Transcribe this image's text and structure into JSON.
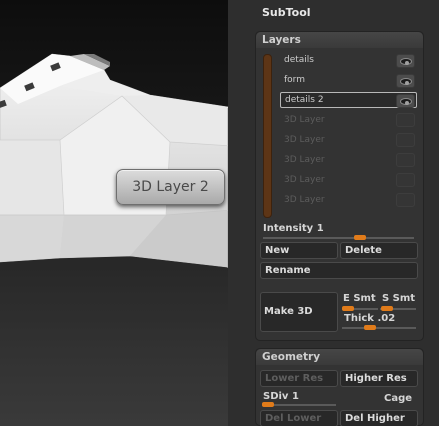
{
  "viewport": {
    "tooltip": "3D Layer 2"
  },
  "subtool": {
    "title": "SubTool"
  },
  "layers_panel": {
    "title": "Layers",
    "items": [
      {
        "label": "details",
        "enabled": true,
        "selected": false
      },
      {
        "label": "form",
        "enabled": true,
        "selected": false
      },
      {
        "label": "details 2",
        "enabled": true,
        "selected": true
      },
      {
        "label": "3D Layer",
        "enabled": false,
        "selected": false
      },
      {
        "label": "3D Layer",
        "enabled": false,
        "selected": false
      },
      {
        "label": "3D Layer",
        "enabled": false,
        "selected": false
      },
      {
        "label": "3D Layer",
        "enabled": false,
        "selected": false
      },
      {
        "label": "3D Layer",
        "enabled": false,
        "selected": false
      }
    ],
    "intensity": {
      "label": "Intensity",
      "value": "1"
    },
    "new_label": "New",
    "delete_label": "Delete",
    "rename_label": "Rename",
    "make3d_label": "Make 3D",
    "e_smt_label": "E Smt",
    "s_smt_label": "S Smt",
    "thick": {
      "label": "Thick",
      "value": ".02"
    }
  },
  "geometry_panel": {
    "title": "Geometry",
    "lower_res_label": "Lower Res",
    "higher_res_label": "Higher Res",
    "sdiv": {
      "label": "SDiv",
      "value": "1"
    },
    "cage_label": "Cage",
    "del_lower_label": "Del Lower",
    "del_higher_label": "Del Higher"
  },
  "colors": {
    "accent": "#e07b1a",
    "panel_bg": "#333333",
    "scroll_track": "#5d3516"
  }
}
